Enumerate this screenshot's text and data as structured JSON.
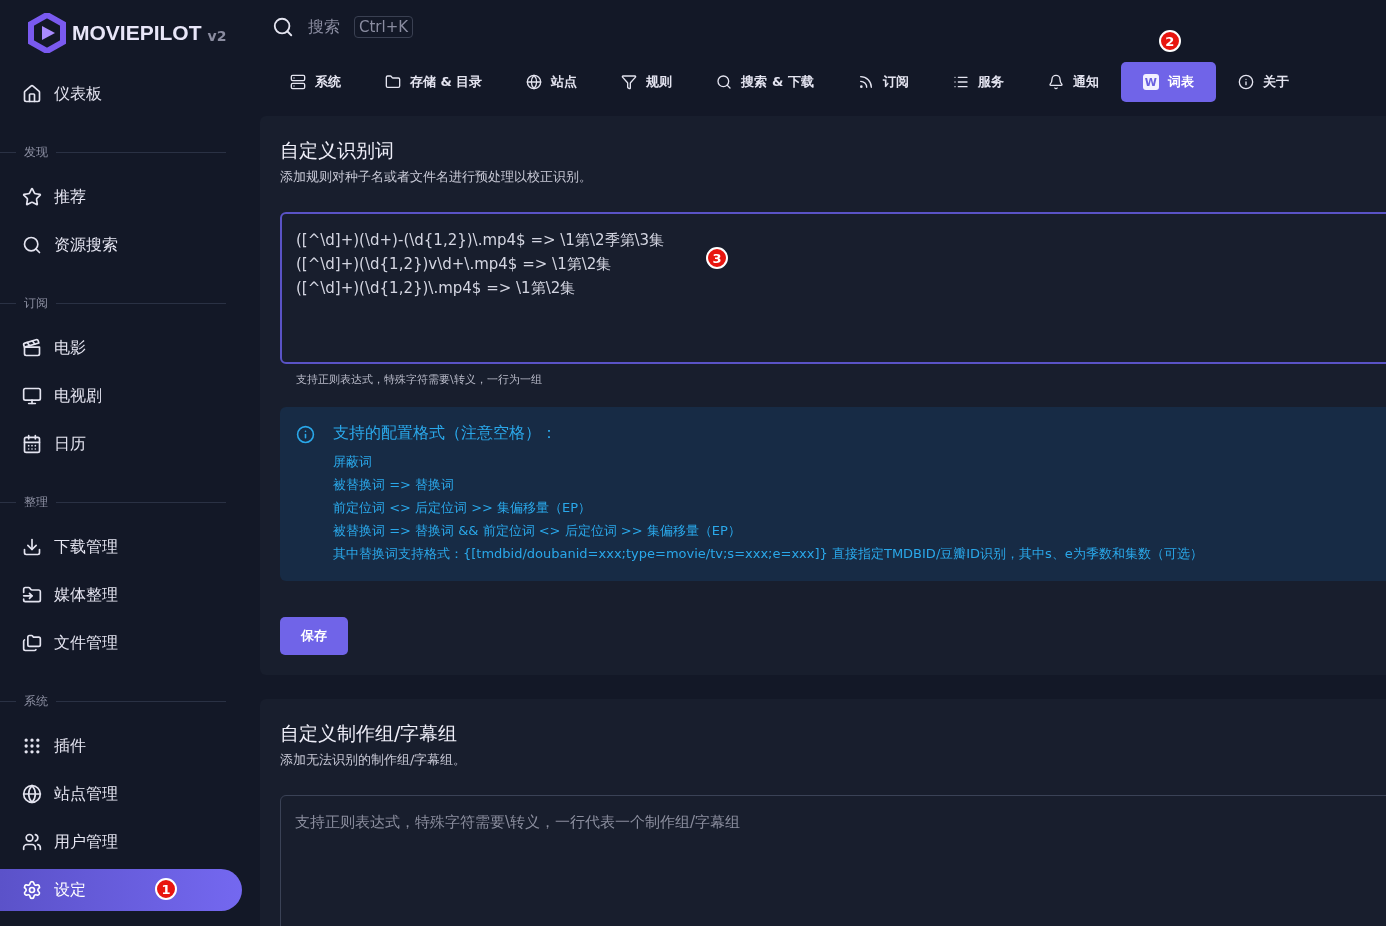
{
  "brand": {
    "name": "MOVIEPILOT",
    "version": "v2"
  },
  "search": {
    "placeholder": "搜索",
    "shortcut": "Ctrl+K"
  },
  "sidebar": {
    "top": [
      {
        "label": "仪表板",
        "selected": false
      }
    ],
    "groups": [
      {
        "title": "发现",
        "items": [
          {
            "label": "推荐",
            "selected": false
          },
          {
            "label": "资源搜索",
            "selected": false
          }
        ]
      },
      {
        "title": "订阅",
        "items": [
          {
            "label": "电影",
            "selected": false
          },
          {
            "label": "电视剧",
            "selected": false
          },
          {
            "label": "日历",
            "selected": false
          }
        ]
      },
      {
        "title": "整理",
        "items": [
          {
            "label": "下载管理",
            "selected": false
          },
          {
            "label": "媒体整理",
            "selected": false
          },
          {
            "label": "文件管理",
            "selected": false
          }
        ]
      },
      {
        "title": "系统",
        "items": [
          {
            "label": "插件",
            "selected": false
          },
          {
            "label": "站点管理",
            "selected": false
          },
          {
            "label": "用户管理",
            "selected": false
          },
          {
            "label": "设定",
            "selected": true,
            "callout": "1"
          }
        ]
      }
    ]
  },
  "tabs": [
    {
      "label": "系统",
      "selected": false
    },
    {
      "label": "存储 & 目录",
      "selected": false
    },
    {
      "label": "站点",
      "selected": false
    },
    {
      "label": "规则",
      "selected": false
    },
    {
      "label": "搜索 & 下载",
      "selected": false
    },
    {
      "label": "订阅",
      "selected": false
    },
    {
      "label": "服务",
      "selected": false
    },
    {
      "label": "通知",
      "selected": false
    },
    {
      "label": "词表",
      "icon_text": "W",
      "selected": true,
      "callout": "2"
    },
    {
      "label": "关于",
      "selected": false
    }
  ],
  "cards": [
    {
      "title": "自定义识别词",
      "subtitle": "添加规则对种子名或者文件名进行预处理以校正识别。",
      "field": {
        "lines": [
          "([^\\d]+)(\\d+)-(\\d{1,2})\\.mp4$ => \\1第\\2季第\\3集",
          "([^\\d]+)(\\d{1,2})v\\d+\\.mp4$ => \\1第\\2集",
          "([^\\d]+)(\\d{1,2})\\.mp4$ => \\1第\\2集"
        ],
        "hint": "支持正则表达式，特殊字符需要\\转义，一行为一组",
        "focused": true,
        "callout": "3"
      },
      "info": {
        "title": "支持的配置格式（注意空格）：",
        "lines": [
          "屏蔽词",
          "被替换词 => 替换词",
          "前定位词 <> 后定位词 >> 集偏移量（EP）",
          "被替换词 => 替换词 && 前定位词 <> 后定位词 >> 集偏移量（EP）",
          "其中替换词支持格式：{[tmdbid/doubanid=xxx;type=movie/tv;s=xxx;e=xxx]} 直接指定TMDBID/豆瓣ID识别，其中s、e为季数和集数（可选）"
        ]
      },
      "button": "保存"
    },
    {
      "title": "自定义制作组/字幕组",
      "subtitle": "添加无法识别的制作组/字幕组。",
      "field": {
        "placeholder": "支持正则表达式，特殊字符需要\\转义，一行代表一个制作组/字幕组",
        "focused": false
      }
    }
  ]
}
